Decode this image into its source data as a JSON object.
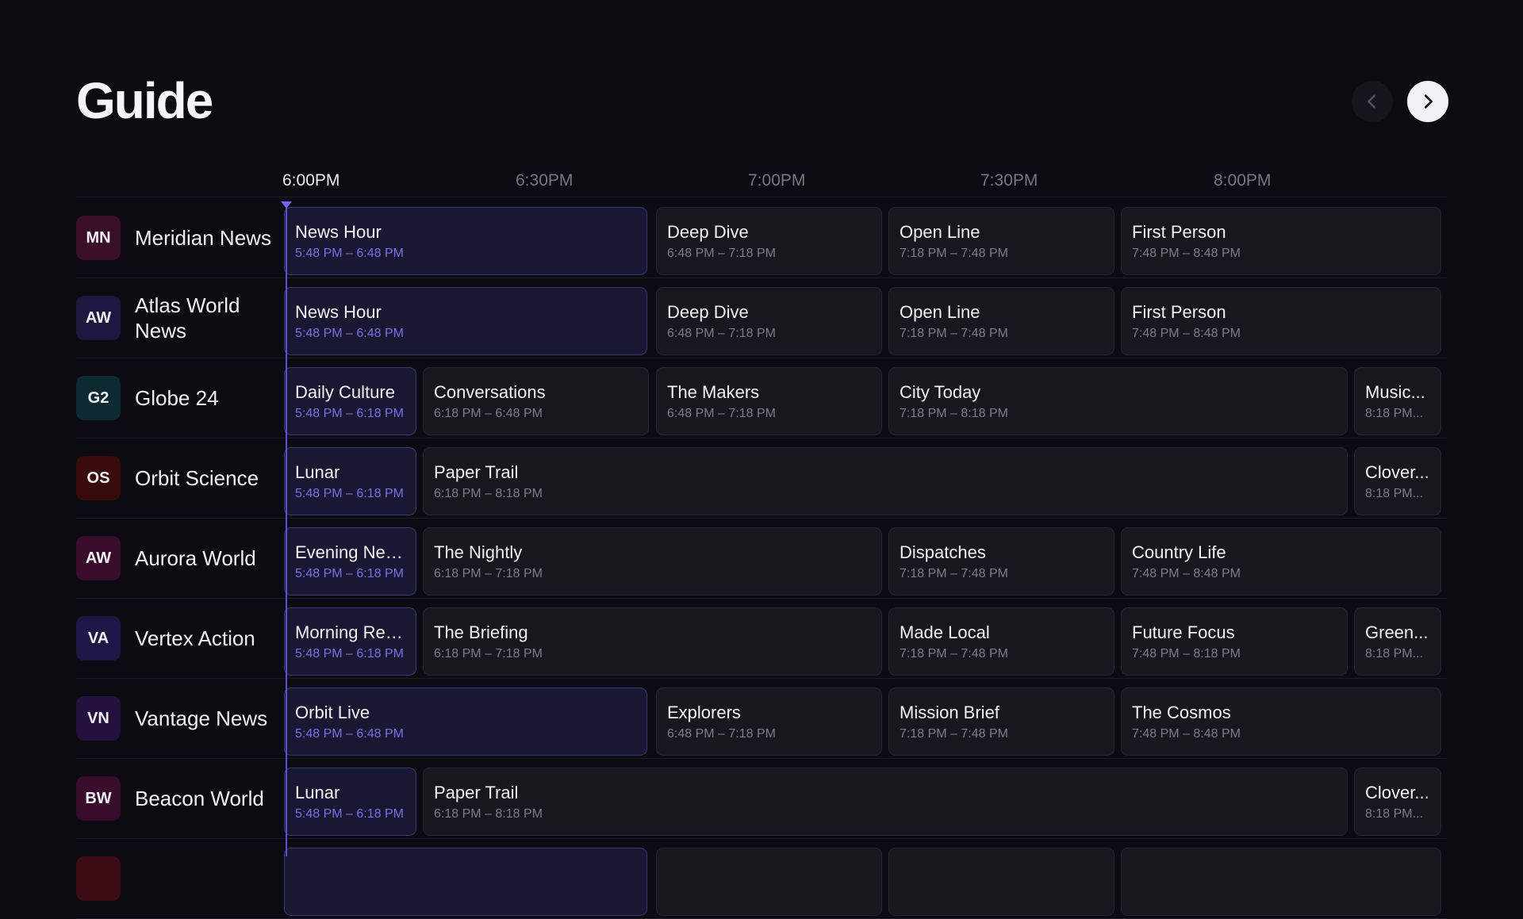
{
  "header": {
    "title": "Guide",
    "prev_icon": "chevron-left-icon",
    "next_icon": "chevron-right-icon"
  },
  "timeline": {
    "labels": [
      "6:00PM",
      "6:30PM",
      "7:00PM",
      "7:30PM",
      "8:00PM"
    ],
    "current_label": "6:00PM"
  },
  "colors": {
    "background": "#0b0b11",
    "live_accent": "#7a6fe6",
    "now_line": "#5b4fd8"
  },
  "channels": [
    {
      "abbr": "MN",
      "name": "Meridian News",
      "logo_color": "#3a0f26",
      "programs": [
        {
          "title": "News Hour",
          "time": "5:48 PM – 6:48 PM",
          "live": true
        },
        {
          "title": "Deep Dive",
          "time": "6:48 PM – 7:18 PM"
        },
        {
          "title": "Open Line",
          "time": "7:18 PM – 7:48 PM"
        },
        {
          "title": "First Person",
          "time": "7:48 PM – 8:48 PM"
        }
      ]
    },
    {
      "abbr": "AW",
      "name": "Atlas World News",
      "logo_color": "#1c1840",
      "programs": [
        {
          "title": "News Hour",
          "time": "5:48 PM – 6:48 PM",
          "live": true
        },
        {
          "title": "Deep Dive",
          "time": "6:48 PM – 7:18 PM"
        },
        {
          "title": "Open Line",
          "time": "7:18 PM – 7:48 PM"
        },
        {
          "title": "First Person",
          "time": "7:48 PM – 8:48 PM"
        }
      ]
    },
    {
      "abbr": "G2",
      "name": "Globe 24",
      "logo_color": "#0d2a33",
      "programs": [
        {
          "title": "Daily Culture",
          "time": "5:48 PM – 6:18 PM",
          "live": true
        },
        {
          "title": "Conversations",
          "time": "6:18 PM – 6:48 PM"
        },
        {
          "title": "The Makers",
          "time": "6:48 PM – 7:18 PM"
        },
        {
          "title": "City Today",
          "time": "7:18 PM – 8:18 PM"
        },
        {
          "title": "Music...",
          "time": "8:18 PM..."
        }
      ]
    },
    {
      "abbr": "OS",
      "name": "Orbit Science",
      "logo_color": "#3a0b0b",
      "programs": [
        {
          "title": "Lunar",
          "time": "5:48 PM – 6:18 PM",
          "live": true
        },
        {
          "title": "Paper Trail",
          "time": "6:18 PM – 8:18 PM"
        },
        {
          "title": "Clover...",
          "time": "8:18 PM..."
        }
      ]
    },
    {
      "abbr": "AW",
      "name": "Aurora World",
      "logo_color": "#380c2a",
      "programs": [
        {
          "title": "Evening News",
          "time": "5:48 PM – 6:18 PM",
          "live": true
        },
        {
          "title": "The Nightly",
          "time": "6:18 PM – 7:18 PM"
        },
        {
          "title": "Dispatches",
          "time": "7:18 PM – 7:48 PM"
        },
        {
          "title": "Country Life",
          "time": "7:48 PM – 8:48 PM"
        }
      ]
    },
    {
      "abbr": "VA",
      "name": "Vertex Action",
      "logo_color": "#1b1848",
      "programs": [
        {
          "title": "Morning Rep...",
          "time": "5:48 PM – 6:18 PM",
          "live": true
        },
        {
          "title": "The Briefing",
          "time": "6:18 PM – 7:18 PM"
        },
        {
          "title": "Made Local",
          "time": "7:18 PM – 7:48 PM"
        },
        {
          "title": "Future Focus",
          "time": "7:48 PM – 8:18 PM"
        },
        {
          "title": "Green...",
          "time": "8:18 PM..."
        }
      ]
    },
    {
      "abbr": "VN",
      "name": "Vantage News",
      "logo_color": "#24113e",
      "programs": [
        {
          "title": "Orbit Live",
          "time": "5:48 PM – 6:48 PM",
          "live": true
        },
        {
          "title": "Explorers",
          "time": "6:48 PM – 7:18 PM"
        },
        {
          "title": "Mission Brief",
          "time": "7:18 PM – 7:48 PM"
        },
        {
          "title": "The Cosmos",
          "time": "7:48 PM – 8:48 PM"
        }
      ]
    },
    {
      "abbr": "BW",
      "name": "Beacon World",
      "logo_color": "#3a0c2c",
      "programs": [
        {
          "title": "Lunar",
          "time": "5:48 PM – 6:18 PM",
          "live": true
        },
        {
          "title": "Paper Trail",
          "time": "6:18 PM – 8:18 PM"
        },
        {
          "title": "Clover...",
          "time": "8:18 PM..."
        }
      ]
    },
    {
      "abbr": "",
      "name": "",
      "logo_color": "#3a0b12",
      "programs": [
        {
          "title": "",
          "time": "",
          "live": true
        },
        {
          "title": "",
          "time": ""
        },
        {
          "title": "",
          "time": ""
        },
        {
          "title": "",
          "time": ""
        }
      ]
    }
  ]
}
